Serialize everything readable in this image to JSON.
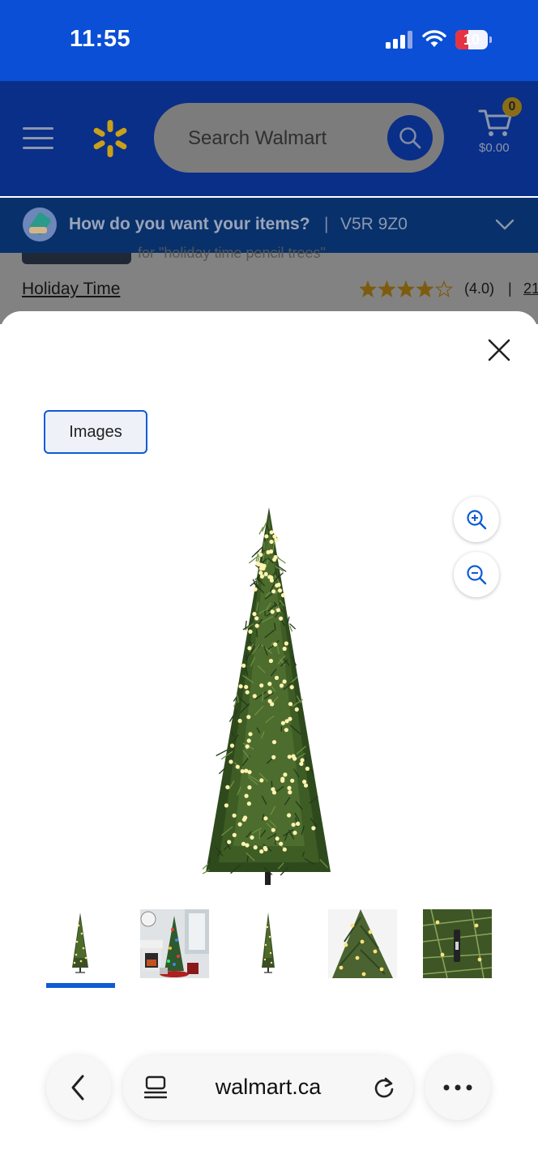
{
  "status_bar": {
    "time": "11:55",
    "battery_level": "10"
  },
  "header": {
    "search_placeholder": "Search Walmart",
    "cart_count": "0",
    "cart_total": "$0.00"
  },
  "delivery": {
    "prompt": "How do you want your items?",
    "separator": "|",
    "postal_code": "V5R 9Z0"
  },
  "product": {
    "partial_text": "for \"holiday time pencil trees\"",
    "brand": "Holiday Time",
    "rating_value": 4.0,
    "rating_text": "(4.0)",
    "rating_separator": "|",
    "review_count_partial": "21"
  },
  "modal": {
    "tab_label": "Images",
    "selected_thumbnail": 1,
    "thumbnails": [
      "tree-front",
      "tree-living-room",
      "tree-small",
      "lights-closeup",
      "branch-closeup"
    ]
  },
  "browser": {
    "url": "walmart.ca"
  },
  "colors": {
    "status_bar": "#0a4fd6",
    "walmart_blue": "#0a2f88",
    "spark_yellow": "#c9a018",
    "selection_blue": "#0d5bd6"
  }
}
